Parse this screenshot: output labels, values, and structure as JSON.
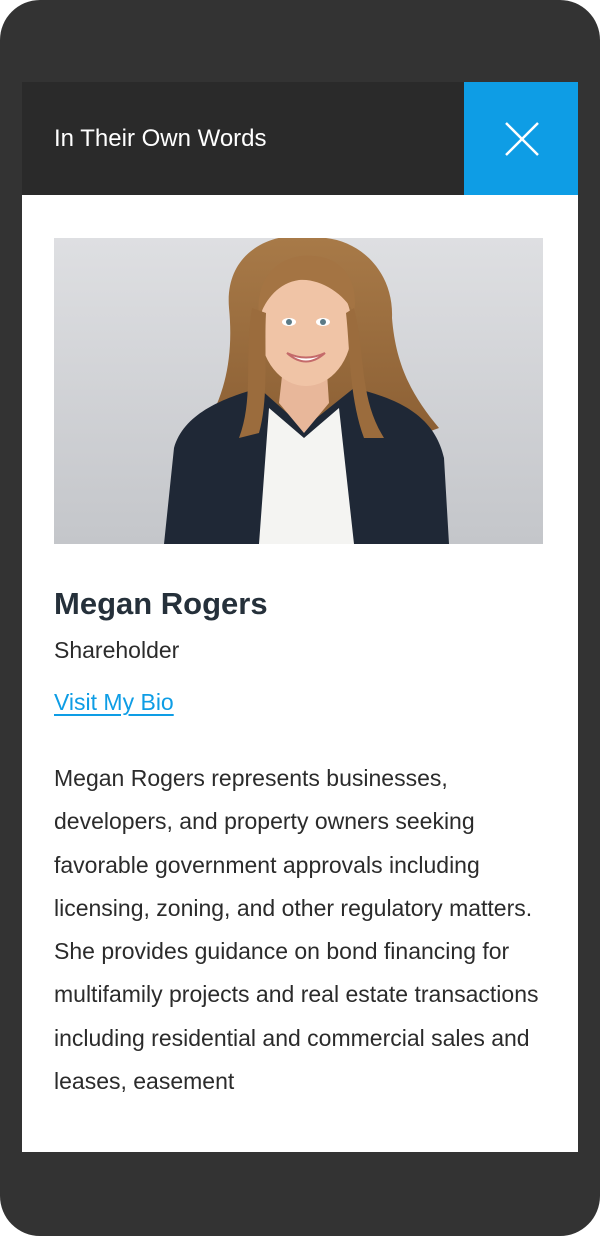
{
  "modal": {
    "title": "In Their Own Words",
    "close_icon": "close-icon"
  },
  "profile": {
    "photo_alt": "Megan Rogers",
    "name": "Megan Rogers",
    "role": "Shareholder",
    "bio_link_label": "Visit My Bio",
    "bio_text": "Megan Rogers represents businesses, developers, and property owners seeking favorable government approvals including licensing, zoning, and other regulatory matters. She provides guidance on bond financing for multifamily projects and real estate transactions including residential and commercial sales and leases, easement"
  },
  "colors": {
    "header_bg": "#2a2a2a",
    "accent": "#0e9de5",
    "frame": "#333333"
  }
}
